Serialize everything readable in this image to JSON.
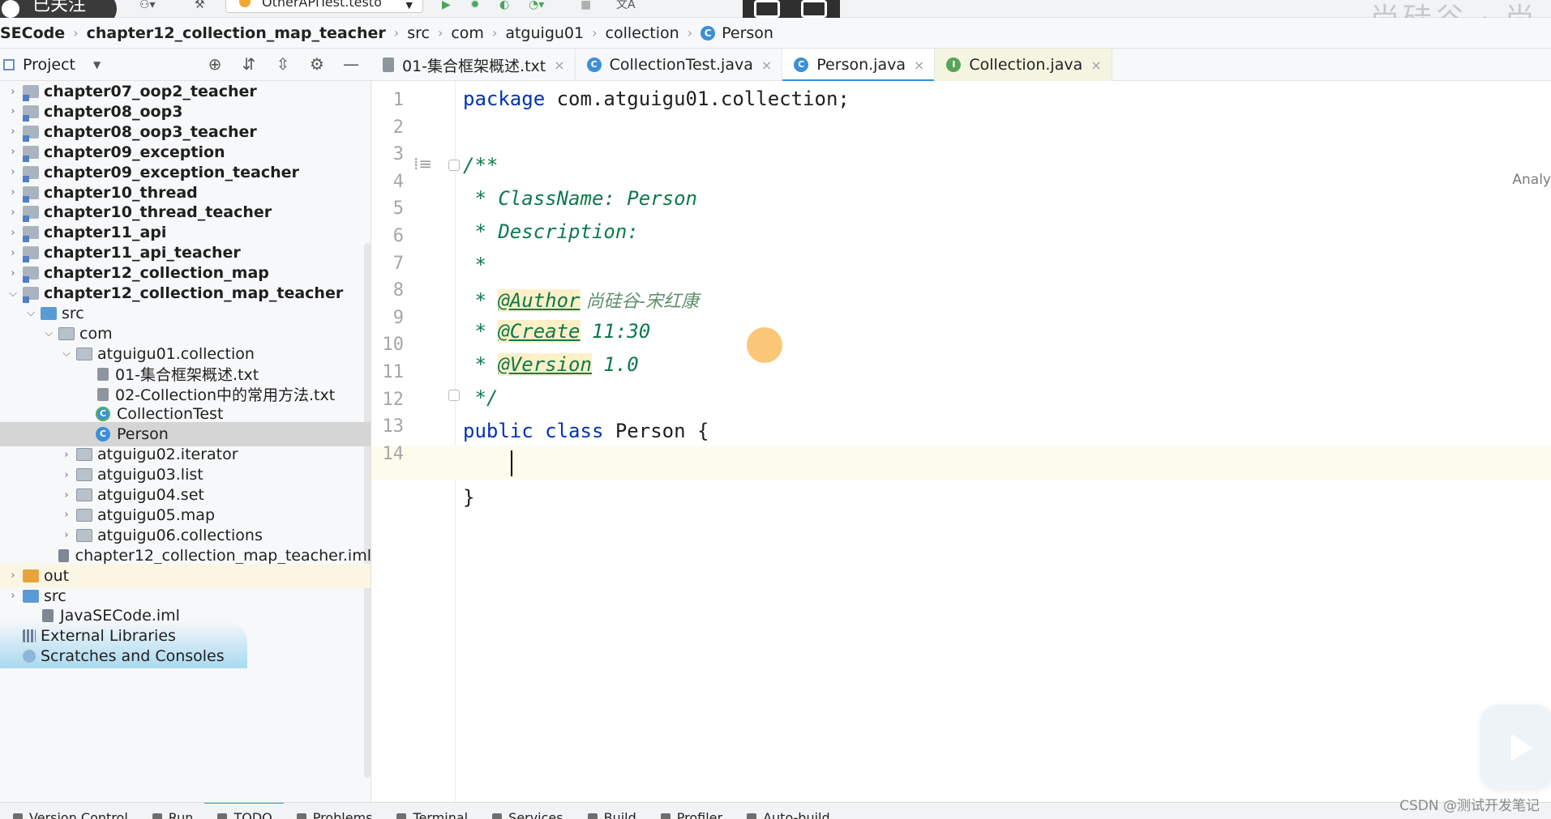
{
  "topbar": {
    "follow_label": "已关注",
    "run_config": "OtherAPITest.testo",
    "watermark": "尚硅谷 · 尚"
  },
  "breadcrumb": {
    "items": [
      "SECode",
      "chapter12_collection_map_teacher",
      "src",
      "com",
      "atguigu01",
      "collection",
      "Person"
    ]
  },
  "project": {
    "title": "Project",
    "tree": [
      {
        "label": "chapter07_oop2_teacher",
        "indent": 0,
        "type": "module",
        "arrow": "›",
        "bold": true
      },
      {
        "label": "chapter08_oop3",
        "indent": 0,
        "type": "module",
        "arrow": "›",
        "bold": true
      },
      {
        "label": "chapter08_oop3_teacher",
        "indent": 0,
        "type": "module",
        "arrow": "›",
        "bold": true
      },
      {
        "label": "chapter09_exception",
        "indent": 0,
        "type": "module",
        "arrow": "›",
        "bold": true
      },
      {
        "label": "chapter09_exception_teacher",
        "indent": 0,
        "type": "module",
        "arrow": "›",
        "bold": true
      },
      {
        "label": "chapter10_thread",
        "indent": 0,
        "type": "module",
        "arrow": "›",
        "bold": true
      },
      {
        "label": "chapter10_thread_teacher",
        "indent": 0,
        "type": "module",
        "arrow": "›",
        "bold": true
      },
      {
        "label": "chapter11_api",
        "indent": 0,
        "type": "module",
        "arrow": "›",
        "bold": true
      },
      {
        "label": "chapter11_api_teacher",
        "indent": 0,
        "type": "module",
        "arrow": "›",
        "bold": true
      },
      {
        "label": "chapter12_collection_map",
        "indent": 0,
        "type": "module",
        "arrow": "›",
        "bold": true
      },
      {
        "label": "chapter12_collection_map_teacher",
        "indent": 0,
        "type": "module",
        "arrow": "⌄",
        "bold": true
      },
      {
        "label": "src",
        "indent": 1,
        "type": "srcdir",
        "arrow": "⌄",
        "bold": false
      },
      {
        "label": "com",
        "indent": 2,
        "type": "pkg",
        "arrow": "⌄",
        "bold": false
      },
      {
        "label": "atguigu01.collection",
        "indent": 3,
        "type": "pkg",
        "arrow": "⌄",
        "bold": false
      },
      {
        "label": "01-集合框架概述.txt",
        "indent": 4,
        "type": "txt",
        "arrow": "",
        "bold": false
      },
      {
        "label": "02-Collection中的常用方法.txt",
        "indent": 4,
        "type": "txt",
        "arrow": "",
        "bold": false
      },
      {
        "label": "CollectionTest",
        "indent": 4,
        "type": "class-test",
        "arrow": "",
        "bold": false
      },
      {
        "label": "Person",
        "indent": 4,
        "type": "class",
        "arrow": "",
        "bold": false,
        "selected": true
      },
      {
        "label": "atguigu02.iterator",
        "indent": 3,
        "type": "pkg",
        "arrow": "›",
        "bold": false
      },
      {
        "label": "atguigu03.list",
        "indent": 3,
        "type": "pkg",
        "arrow": "›",
        "bold": false
      },
      {
        "label": "atguigu04.set",
        "indent": 3,
        "type": "pkg",
        "arrow": "›",
        "bold": false
      },
      {
        "label": "atguigu05.map",
        "indent": 3,
        "type": "pkg",
        "arrow": "›",
        "bold": false
      },
      {
        "label": "atguigu06.collections",
        "indent": 3,
        "type": "pkg",
        "arrow": "›",
        "bold": false
      },
      {
        "label": "chapter12_collection_map_teacher.iml",
        "indent": 2,
        "type": "iml",
        "arrow": "",
        "bold": false
      },
      {
        "label": "out",
        "indent": 0,
        "type": "out",
        "arrow": "›",
        "bold": false,
        "highlight": true
      },
      {
        "label": "src",
        "indent": 0,
        "type": "srcdir",
        "arrow": "›",
        "bold": false
      },
      {
        "label": "JavaSECode.iml",
        "indent": 1,
        "type": "iml",
        "arrow": "",
        "bold": false
      },
      {
        "label": "External Libraries",
        "indent": 0,
        "type": "lib",
        "arrow": "",
        "bold": false
      },
      {
        "label": "Scratches and Consoles",
        "indent": 0,
        "type": "scratch",
        "arrow": "",
        "bold": false
      }
    ]
  },
  "tabs": [
    {
      "label": "01-集合框架概述.txt",
      "icon": "txt",
      "active": false
    },
    {
      "label": "CollectionTest.java",
      "icon": "cls",
      "active": false
    },
    {
      "label": "Person.java",
      "icon": "cls",
      "active": true
    },
    {
      "label": "Collection.java",
      "icon": "iface",
      "active": false,
      "pinned": true
    }
  ],
  "editor": {
    "analyze_label": "Analy",
    "lines": [
      "1",
      "2",
      "3",
      "4",
      "5",
      "6",
      "7",
      "8",
      "9",
      "10",
      "11",
      "12",
      "13",
      "14"
    ],
    "code": {
      "l1_kw": "package",
      "l1_rest": " com.atguigu01.collection;",
      "l3": "/**",
      "l4_star": " * ",
      "l4_text": "ClassName: Person",
      "l5_star": " * ",
      "l5_text": "Description:",
      "l6": " *",
      "l7_star": " * ",
      "l7_tag": "@Author",
      "l7_val": " 尚硅谷-宋红康",
      "l8_star": " * ",
      "l8_tag": "@Create",
      "l8_val": " 11:30",
      "l9_star": " * ",
      "l9_tag": "@Version",
      "l9_val": " 1.0",
      "l10": " */",
      "l11_kw1": "public",
      "l11_kw2": "class",
      "l11_rest": " Person {",
      "l13": "}"
    }
  },
  "bottom_bar": {
    "items": [
      "Version Control",
      "Run",
      "TODO",
      "Problems",
      "Terminal",
      "Services",
      "Build",
      "Profiler",
      "Auto-build"
    ]
  },
  "csdn": "CSDN @测试开发笔记"
}
